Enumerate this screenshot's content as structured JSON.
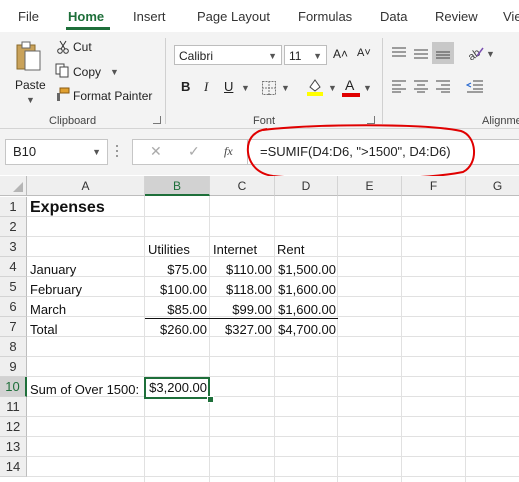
{
  "menu": {
    "tabs": [
      "File",
      "Home",
      "Insert",
      "Page Layout",
      "Formulas",
      "Data",
      "Review",
      "Vie"
    ],
    "active": "Home"
  },
  "clipboard": {
    "paste": "Paste",
    "cut": "Cut",
    "copy": "Copy",
    "format_painter": "Format Painter",
    "label": "Clipboard"
  },
  "font": {
    "name": "Calibri",
    "size": "11",
    "bold": "B",
    "italic": "I",
    "underline": "U",
    "grow": "A˄",
    "shrink": "A˅",
    "font_color_glyph": "A",
    "label": "Font",
    "highlight_color": "#ffff00",
    "font_color": "#e00000"
  },
  "alignment": {
    "label": "Alignme"
  },
  "formula_bar": {
    "name_box": "B10",
    "cancel": "✕",
    "enter": "✓",
    "fx": "fx",
    "formula": "=SUMIF(D4:D6, \">1500\", D4:D6)",
    "annotation_color": "#e00000"
  },
  "grid": {
    "columns": [
      "A",
      "B",
      "C",
      "D",
      "E",
      "F",
      "G"
    ],
    "rows": [
      "1",
      "2",
      "3",
      "4",
      "5",
      "6",
      "7",
      "8",
      "9",
      "10",
      "11",
      "12",
      "13",
      "14"
    ],
    "selected_cell": "B10",
    "accent": "#1e6f3a",
    "cells": {
      "a1": "Expenses",
      "b3": "Utilities",
      "c3": "Internet",
      "d3": "Rent",
      "a4": "January",
      "b4": "$75.00",
      "c4": "$110.00",
      "d4": "$1,500.00",
      "a5": "February",
      "b5": "$100.00",
      "c5": "$118.00",
      "d5": "$1,600.00",
      "a6": "March",
      "b6": "$85.00",
      "c6": "$99.00",
      "d6": "$1,600.00",
      "a7": "Total",
      "b7": "$260.00",
      "c7": "$327.00",
      "d7": "$4,700.00",
      "a10": "Sum of Over 1500:",
      "b10": "$3,200.00"
    }
  }
}
